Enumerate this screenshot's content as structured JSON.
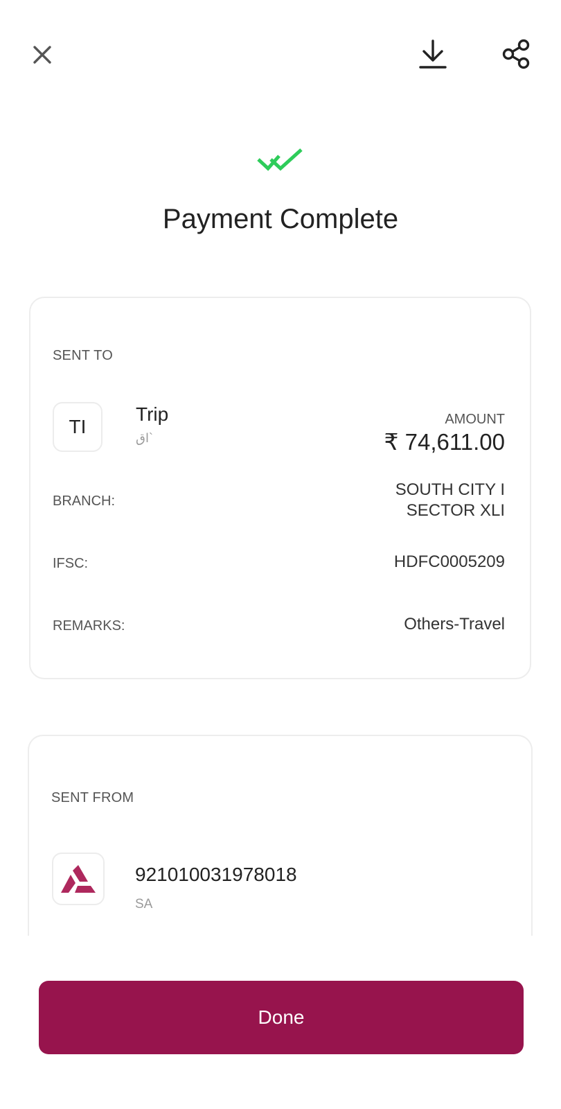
{
  "header": {
    "close_icon": "close-icon",
    "download_icon": "download-icon",
    "share_icon": "share-icon"
  },
  "status": {
    "icon": "double-check-icon",
    "icon_color": "#2ecc5a",
    "title": "Payment Complete"
  },
  "sent_to": {
    "section_label": "SENT TO",
    "avatar_initials": "TI",
    "payee_name": "Trip",
    "payee_sub": "اق`",
    "amount_label": "AMOUNT",
    "amount_value": "₹ 74,611.00",
    "branch_label": "BRANCH:",
    "branch_value_line1": "SOUTH CITY I",
    "branch_value_line2": "SECTOR XLI",
    "ifsc_label": "IFSC:",
    "ifsc_value": "HDFC0005209",
    "remarks_label": "REMARKS:",
    "remarks_value": "Others-Travel"
  },
  "sent_from": {
    "section_label": "SENT FROM",
    "bank_logo": "axis-bank-logo",
    "logo_color": "#ae285d",
    "account_number": "921010031978018",
    "account_type": "SA"
  },
  "footer": {
    "done_label": "Done",
    "button_color": "#97144d"
  }
}
